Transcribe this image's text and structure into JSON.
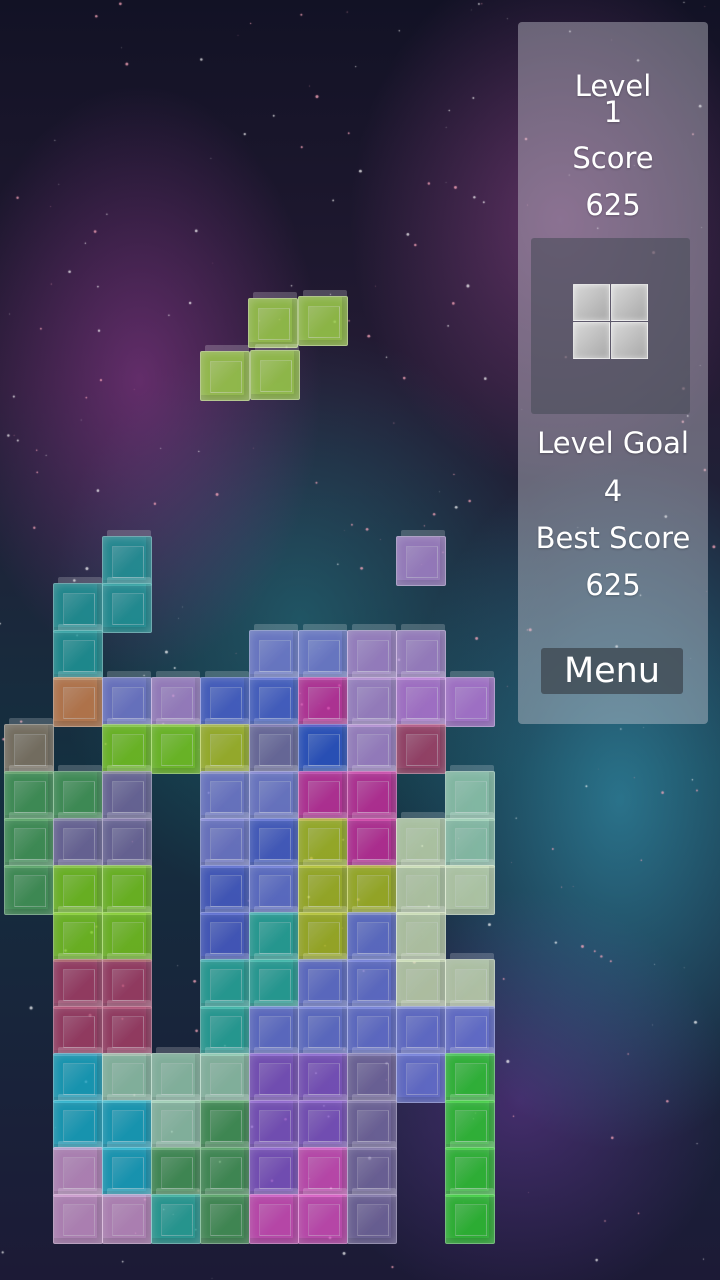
{
  "hud": {
    "level_label": "Level",
    "level_value": "1",
    "score_label": "Score",
    "score_value": "625",
    "level_goal_label": "Level Goal",
    "level_goal_value": "4",
    "best_score_label": "Best Score",
    "best_score_value": "625",
    "menu_label": "Menu"
  },
  "next_piece": {
    "shape": "O",
    "color": "#c0c0c0"
  },
  "falling_piece": {
    "shape": "S",
    "color": "#9ed04a"
  },
  "palette": {
    "lime": "#9ed04a",
    "teal": "#1fa0a0",
    "orange": "#d9864e",
    "brown": "#8e7e68",
    "green": "#4aa35a",
    "lgreen": "#7fd41c",
    "yellow": "#b6c620",
    "periwinkle": "#7c80dc",
    "blue": "#4e62d6",
    "dblue": "#2e52d0",
    "lavender": "#b48ad6",
    "violet": "#c27ae0",
    "magenta": "#d42ca2",
    "pink": "#e052c6",
    "dpink": "#b2406a",
    "mint": "#9ed6b6",
    "pale": "#d2e6b8",
    "cyan": "#18b4d0",
    "aqua": "#2ab6a6",
    "lpink": "#d29ad2",
    "purple": "#8a5ad2",
    "slate": "#7c70a8",
    "bgreen": "#2ed42e",
    "gray": "#7a7a9c",
    "lblue": "#6c7ae0"
  }
}
